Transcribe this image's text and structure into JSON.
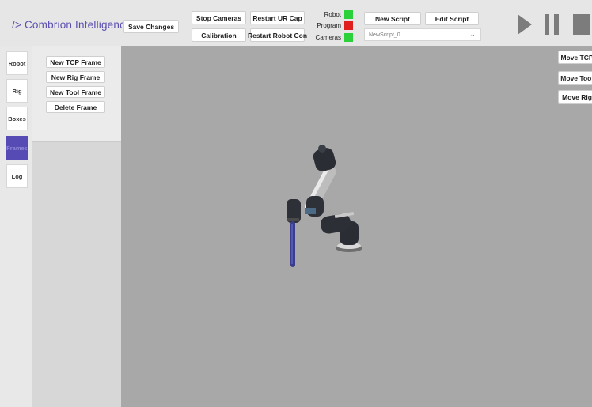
{
  "header": {
    "logo_text": "/> Combrion Intelligence",
    "save_label": "Save Changes",
    "stop_cameras_label": "Stop Cameras",
    "restart_urcap_label": "Restart UR Cap",
    "calibration_label": "Calibration",
    "restart_robot_label": "Restart Robot Con",
    "new_script_label": "New Script",
    "edit_script_label": "Edit Script",
    "script_select_value": "NewScript_0"
  },
  "status": {
    "robot_label": "Robot",
    "program_label": "Program",
    "cameras_label": "Cameras",
    "robot_color": "#2bd13b",
    "program_color": "#e01e1e",
    "cameras_color": "#2bd13b"
  },
  "playback": {
    "play_icon": "play-icon",
    "pause_icon": "pause-icon",
    "stop_icon": "stop-icon",
    "color": "#7c7c7c"
  },
  "tabs": [
    {
      "label": "Robot"
    },
    {
      "label": "Rig"
    },
    {
      "label": "Boxes"
    },
    {
      "label": "Frames"
    },
    {
      "label": "Log"
    }
  ],
  "frames_panel": {
    "new_tcp_label": "New TCP Frame",
    "new_rig_label": "New Rig Frame",
    "new_tool_label": "New Tool Frame",
    "delete_label": "Delete Frame"
  },
  "move_buttons": [
    {
      "label": "Move TCP"
    },
    {
      "label": "Move Tool"
    },
    {
      "label": "Move Rig"
    }
  ],
  "colors": {
    "accent": "#564bb5",
    "viewport_bg": "#a8a8a8"
  }
}
